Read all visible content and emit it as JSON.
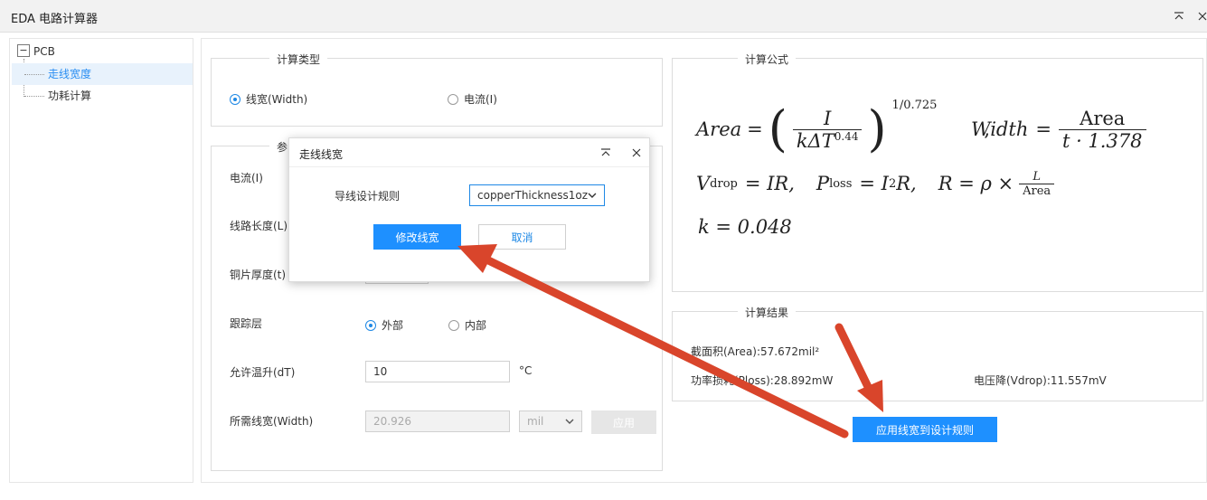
{
  "window": {
    "title": "EDA 电路计算器",
    "collapse_icon": "chevron-up-icon",
    "close_icon": "close-icon"
  },
  "tree": {
    "root": {
      "toggle": "−",
      "label": "PCB"
    },
    "items": [
      {
        "label": "走线宽度",
        "selected": true
      },
      {
        "label": "功耗计算",
        "selected": false
      }
    ]
  },
  "calc_type": {
    "title": "计算类型",
    "options": [
      {
        "label": "线宽(Width)",
        "checked": true
      },
      {
        "label": "电流(I)",
        "checked": false
      }
    ]
  },
  "params": {
    "title": "参",
    "current_label": "电流(I)",
    "length_label": "线路长度(L)",
    "thickness_label": "铜片厚度(t)",
    "layer_label": "跟踪层",
    "layer_options": [
      {
        "label": "外部",
        "checked": true
      },
      {
        "label": "内部",
        "checked": false
      }
    ],
    "temp_label": "允许温升(dT)",
    "temp_value": "10",
    "temp_unit": "°C",
    "width_label": "所需线宽(Width)",
    "width_value": "20.926",
    "width_unit": "mil",
    "apply_label": "应用"
  },
  "formula": {
    "title": "计算公式",
    "area_lhs": "Area",
    "eq": "=",
    "I": "I",
    "k_dT": "kΔT",
    "exp_044": "0.44",
    "exp_outer": "1/0.725",
    "comma": ",",
    "width_lhs": "Width",
    "area_word": "Area",
    "t_den": "t · 1.378",
    "vdrop": "V",
    "vdrop_sub": "drop",
    "IR": "= IR,",
    "ploss": "P",
    "ploss_sub": "loss",
    "I2R": "= I",
    "sq": "2",
    "R_tail": "R,",
    "R_eq": "R = ρ ×",
    "L": "L",
    "k_line": "k = 0.048"
  },
  "results": {
    "title": "计算结果",
    "area": "截面积(Area):57.672mil²",
    "power": "功率损耗(Ploss):28.892mW",
    "vdrop": "电压降(Vdrop):11.557mV",
    "apply_to_rules": "应用线宽到设计规则"
  },
  "dialog": {
    "title": "走线线宽",
    "rule_label": "导线设计规则",
    "rule_value": "copperThickness1oz",
    "modify": "修改线宽",
    "cancel": "取消"
  },
  "colors": {
    "accent": "#1e90ff",
    "annotation_arrow": "#d9452b"
  }
}
